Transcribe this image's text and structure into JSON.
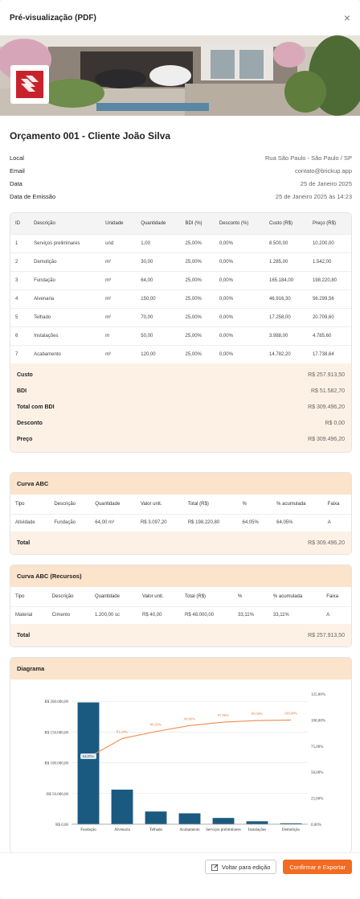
{
  "modal": {
    "title": "Pré-visualização (PDF)",
    "close_label": "×"
  },
  "doc": {
    "title": "Orçamento 001 - Cliente João Silva",
    "fields": [
      {
        "k": "Local",
        "v": "Rua São Paulo - São Paulo / SP"
      },
      {
        "k": "Email",
        "v": "contato@brickup.app"
      },
      {
        "k": "Data",
        "v": "25 de Janeiro 2025"
      },
      {
        "k": "Data de Emissão",
        "v": "25 de Janeiro 2025 às 14:23"
      }
    ]
  },
  "budget": {
    "headers": [
      "ID",
      "Descrição",
      "Unidade",
      "Quantidade",
      "BDI (%)",
      "Desconto (%)",
      "Custo (R$)",
      "Preço (R$)"
    ],
    "rows": [
      [
        "1",
        "Serviços preliminares",
        "und",
        "1,00",
        "25,00%",
        "0,00%",
        "8.500,00",
        "10.200,00"
      ],
      [
        "2",
        "Demolição",
        "m²",
        "30,00",
        "25,00%",
        "0,00%",
        "1.285,00",
        "1.542,00"
      ],
      [
        "3",
        "Fundação",
        "m³",
        "64,00",
        "25,00%",
        "0,00%",
        "165.184,00",
        "198.220,80"
      ],
      [
        "4",
        "Alvenaria",
        "m²",
        "150,00",
        "25,00%",
        "0,00%",
        "46.916,30",
        "56.299,56"
      ],
      [
        "5",
        "Telhado",
        "m²",
        "70,00",
        "25,00%",
        "0,00%",
        "17.258,00",
        "20.709,60"
      ],
      [
        "6",
        "Instalações",
        "m",
        "50,00",
        "25,00%",
        "0,00%",
        "3.988,00",
        "4.785,60"
      ],
      [
        "7",
        "Acabamento",
        "m²",
        "120,00",
        "25,00%",
        "0,00%",
        "14.782,20",
        "17.738,64"
      ]
    ],
    "totals": [
      {
        "k": "Custo",
        "v": "R$ 257.913,50"
      },
      {
        "k": "BDI",
        "v": "R$ 51.582,70"
      },
      {
        "k": "Total com BDI",
        "v": "R$ 309.496,20"
      },
      {
        "k": "Desconto",
        "v": "R$ 0,00"
      },
      {
        "k": "Preço",
        "v": "R$ 309.496,20"
      }
    ]
  },
  "abc": {
    "title": "Curva ABC",
    "headers": [
      "Tipo",
      "Descrição",
      "Quantidade",
      "Valor unit.",
      "Total (R$)",
      "%",
      "% acumulada",
      "Faixa"
    ],
    "rows": [
      [
        "Atividade",
        "Fundação",
        "64,00 m³",
        "R$ 3.097,20",
        "R$ 198.220,80",
        "64,05%",
        "64,05%",
        "A"
      ]
    ],
    "total_label": "Total",
    "total_value": "R$ 309.496,20"
  },
  "abc_res": {
    "title": "Curva ABC (Recursos)",
    "headers": [
      "Tipo",
      "Descrição",
      "Quantidade",
      "Valor unit.",
      "Total (R$)",
      "%",
      "% acumulada",
      "Faixa"
    ],
    "rows": [
      [
        "Material",
        "Cimento",
        "1.200,00 sc",
        "R$ 40,00",
        "R$ 48.000,00",
        "33,11%",
        "33,11%",
        "A"
      ]
    ],
    "total_label": "Total",
    "total_value": "R$ 257.913,50"
  },
  "diagram": {
    "title": "Diagrama"
  },
  "chart_data": {
    "type": "bar",
    "categories": [
      "Fundação",
      "Alvenaria",
      "Telhado",
      "Acabamento",
      "Serviços preliminares",
      "Instalações",
      "Demolição"
    ],
    "series": [
      {
        "name": "",
        "type": "bar",
        "values": [
          198220.8,
          56299.56,
          20709.6,
          17738.64,
          10200.0,
          4785.6,
          1542.0
        ]
      },
      {
        "name": "",
        "type": "line",
        "axis": "right",
        "values": [
          64.05,
          82.24,
          88.93,
          94.66,
          97.96,
          99.5,
          100.0
        ],
        "labels": [
          "64,05%",
          "82,24%",
          "88,93%",
          "94,66%",
          "97,96%",
          "99,50%",
          "100,00%"
        ]
      }
    ],
    "y_ticks": [
      "R$ 0,00",
      "R$ 50.000,00",
      "R$ 100.000,00",
      "R$ 150.000,00",
      "R$ 200.000,00"
    ],
    "y2_ticks": [
      "0,00%",
      "25,00%",
      "50,00%",
      "75,00%",
      "100,00%",
      "125,00%"
    ],
    "ylim": [
      0,
      200000
    ],
    "y2lim": [
      0,
      125
    ],
    "bar_color": "#1b5a80",
    "line_color": "#f08a4b",
    "grid": true
  },
  "footer": {
    "back_label": "Voltar para edição",
    "confirm_label": "Confirmar e Exportar"
  },
  "colors": {
    "accent": "#f26b21",
    "section_header": "#fce3cc",
    "totals_bg": "#fdf1e6",
    "logo_red": "#c8232c"
  }
}
